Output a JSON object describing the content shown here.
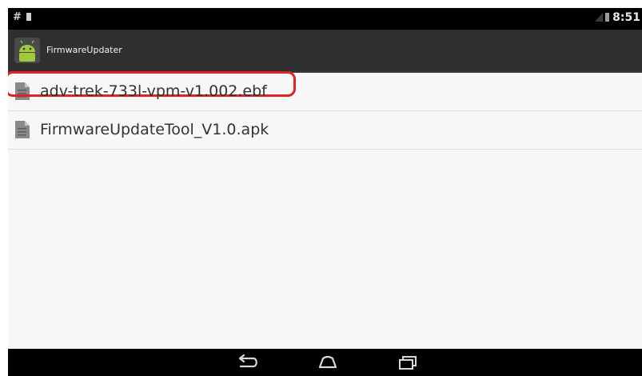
{
  "status_bar": {
    "left_icons": [
      "notification-icon",
      "sd-card-icon"
    ],
    "time": "8:51"
  },
  "app_bar": {
    "icon": "android-icon",
    "title": "FirmwareUpdater"
  },
  "files": [
    {
      "name": "adv-trek-733l-vpm-v1.002.ebf",
      "icon": "file-icon",
      "highlighted": true
    },
    {
      "name": "FirmwareUpdateTool_V1.0.apk",
      "icon": "file-icon",
      "highlighted": false
    }
  ],
  "nav_bar": {
    "buttons": [
      "back-icon",
      "home-icon",
      "recents-icon"
    ]
  },
  "colors": {
    "highlight": "#e02424",
    "android_green": "#9fca3c"
  }
}
